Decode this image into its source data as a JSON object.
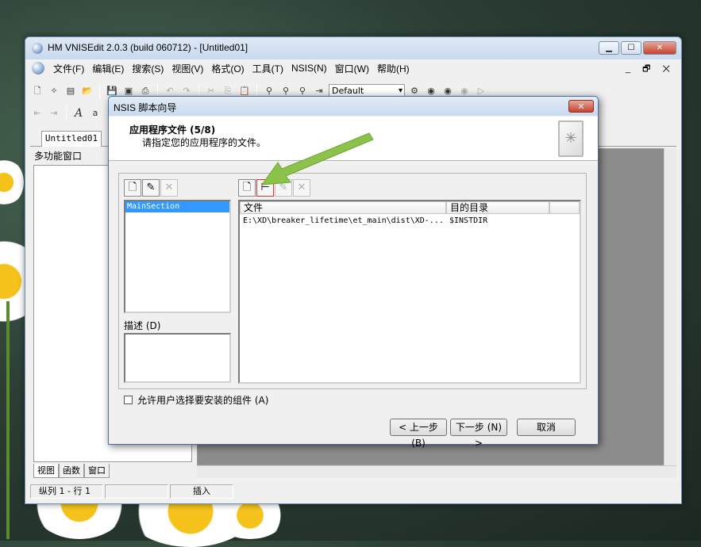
{
  "window": {
    "title": "HM VNISEdit 2.0.3 (build 060712) - [Untitled01]"
  },
  "menu": {
    "items": [
      "文件(F)",
      "编辑(E)",
      "搜索(S)",
      "视图(V)",
      "格式(O)",
      "工具(T)",
      "NSIS(N)",
      "窗口(W)",
      "帮助(H)"
    ],
    "mdi_buttons": "_ 🗗 ✕"
  },
  "toolbar": {
    "combo_value": "Default"
  },
  "doc_tab": "Untitled01",
  "left_panel": {
    "title": "多功能窗口",
    "tabs": [
      "视图",
      "函数",
      "窗口"
    ]
  },
  "statusbar": {
    "position": "纵列 1 - 行 1",
    "mode": "插入"
  },
  "dialog": {
    "title": "NSIS 脚本向导",
    "header_title": "应用程序文件 (5/8)",
    "header_subtitle": "请指定您的应用程序的文件。",
    "sections": [
      "MainSection"
    ],
    "description_label": "描述 (D)",
    "files_columns": [
      "文件",
      "目的目录"
    ],
    "files_rows": [
      {
        "file": "E:\\XD\\breaker_lifetime\\et_main\\dist\\XD-...",
        "dest": "$INSTDIR"
      }
    ],
    "checkbox_label": "允许用户选择要安装的组件 (A)",
    "buttons": {
      "back": "< 上一步 (B)",
      "next": "下一步 (N) >",
      "cancel": "取消"
    }
  }
}
